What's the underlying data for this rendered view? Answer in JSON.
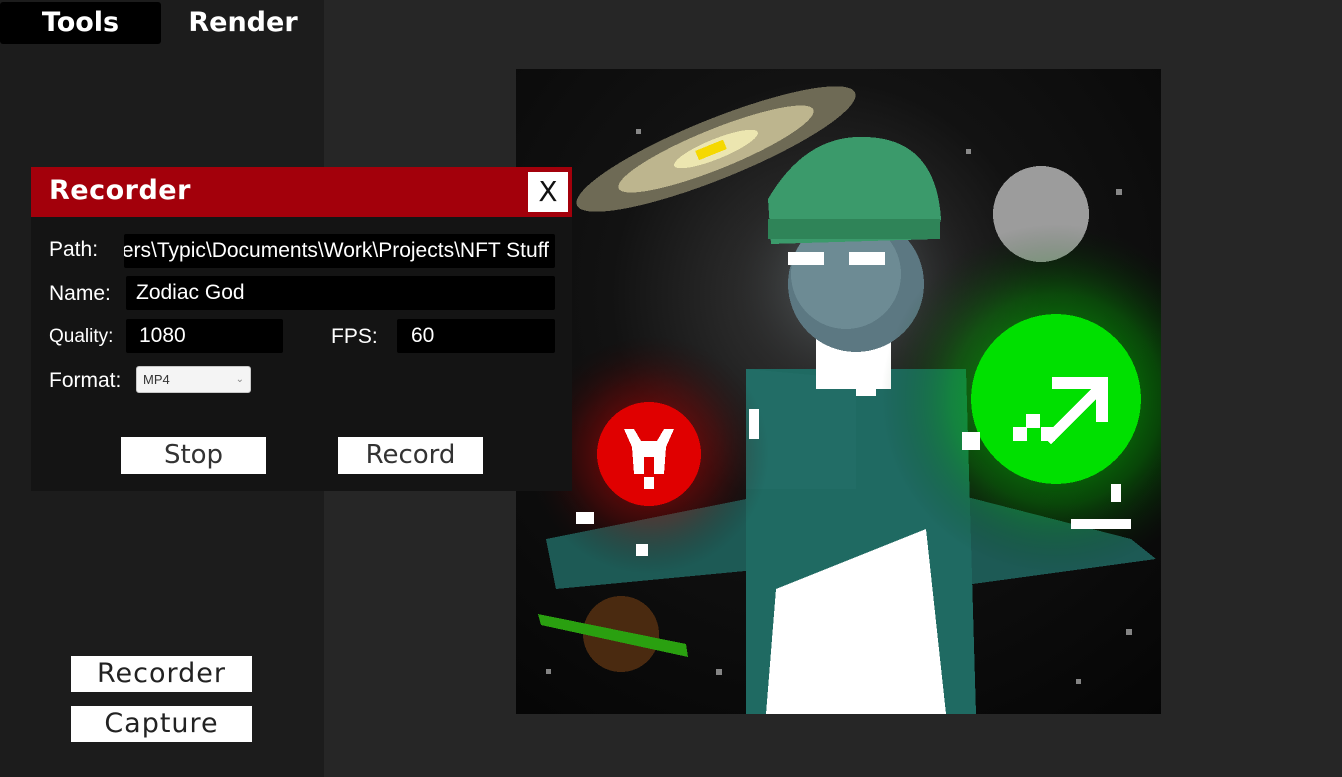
{
  "tabs": {
    "tools": "Tools",
    "render": "Render"
  },
  "sidebar": {
    "recorder_label": "Recorder",
    "capture_label": "Capture"
  },
  "recorder": {
    "title": "Recorder",
    "close_label": "X",
    "path_label": "Path:",
    "path_value": "C:\\Users\\Typic\\Documents\\Work\\Projects\\NFT Stuff",
    "name_label": "Name:",
    "name_value": "Zodiac God",
    "quality_label": "Quality:",
    "quality_value": "1080",
    "fps_label": "FPS:",
    "fps_value": "60",
    "format_label": "Format:",
    "format_value": "MP4",
    "stop_label": "Stop",
    "record_label": "Record"
  },
  "colors": {
    "header_red": "#a3000b",
    "panel_bg": "#141414",
    "sidebar_bg": "#1c1c1c",
    "canvas_bg": "#262626",
    "sagittarius_green": "#00e000",
    "aries_red": "#e00000"
  }
}
